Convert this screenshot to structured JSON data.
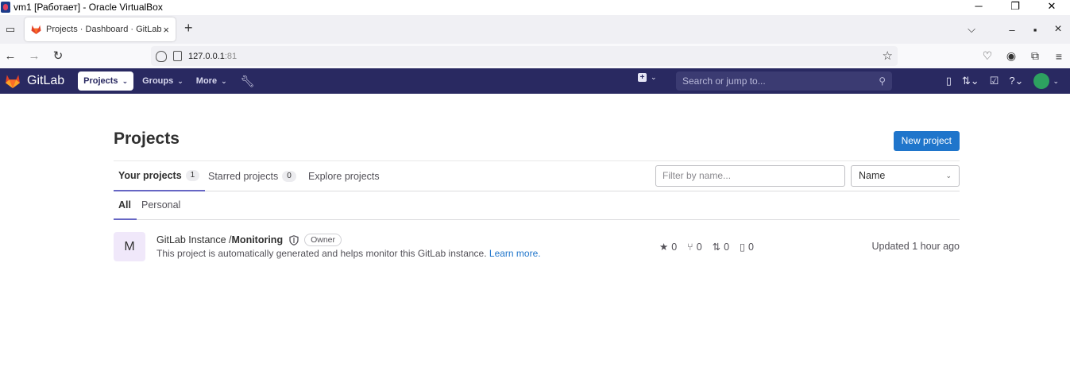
{
  "window": {
    "title": "vm1 [Работает] - Oracle VirtualBox",
    "controls": [
      "─",
      "❐",
      "✕"
    ]
  },
  "browser": {
    "tab_title": "Projects · Dashboard · GitLab",
    "tab_close": "×",
    "new_tab": "+",
    "tab_list": "⌵",
    "window_min": "–",
    "window_max": "▪",
    "window_close": "×",
    "url_host": "127.0.0.1",
    "url_port": ":81",
    "back": "←",
    "forward": "→",
    "reload": "↻",
    "star": "☆"
  },
  "gitlab_nav": {
    "logo_text": "GitLab",
    "projects_label": "Projects",
    "groups_label": "Groups",
    "more_label": "More",
    "search_placeholder": "Search or jump to...",
    "brand_color": "#292961"
  },
  "page": {
    "title": "Projects",
    "new_project_label": "New project",
    "tabs": [
      {
        "label": "Your projects",
        "count": "1",
        "active": true
      },
      {
        "label": "Starred projects",
        "count": "0",
        "active": false
      },
      {
        "label": "Explore projects",
        "count": "",
        "active": false
      }
    ],
    "filter_placeholder": "Filter by name...",
    "sort_value": "Name",
    "sub_tabs": [
      {
        "label": "All",
        "active": true
      },
      {
        "label": "Personal",
        "active": false
      }
    ]
  },
  "projects": [
    {
      "avatar_letter": "M",
      "namespace": "GitLab Instance / ",
      "name": "Monitoring",
      "role": "Owner",
      "description": "This project is automatically generated and helps monitor this GitLab instance. ",
      "learn_more": "Learn more.",
      "stars": "0",
      "forks": "0",
      "merge_requests": "0",
      "issues": "0",
      "updated": "Updated 1 hour ago"
    }
  ]
}
